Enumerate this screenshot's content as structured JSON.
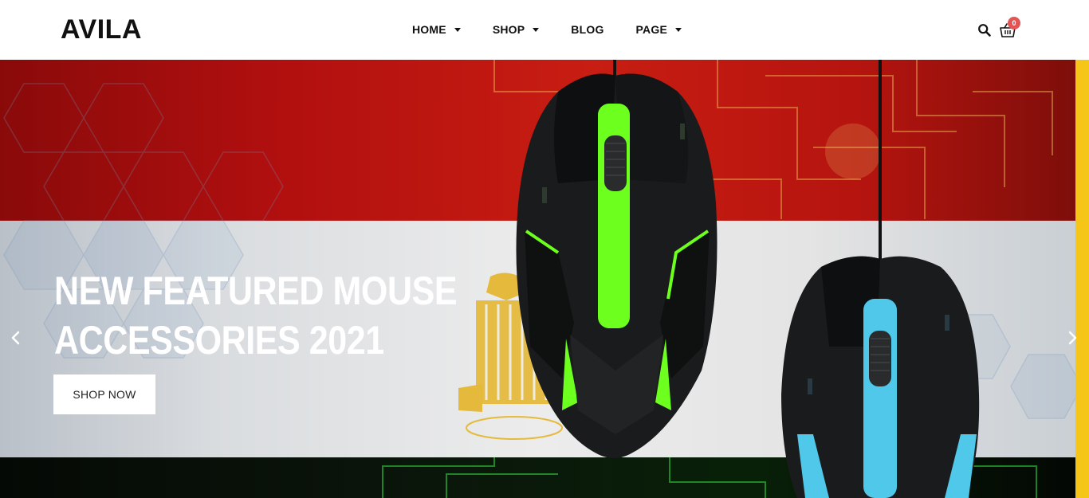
{
  "brand": {
    "logo": "AVILA"
  },
  "nav": {
    "items": [
      {
        "label": "HOME",
        "has_dropdown": true
      },
      {
        "label": "SHOP",
        "has_dropdown": true
      },
      {
        "label": "BLOG",
        "has_dropdown": false
      },
      {
        "label": "PAGE",
        "has_dropdown": true
      }
    ]
  },
  "header_actions": {
    "search_icon": "search-icon",
    "cart_icon": "shopping-basket-icon",
    "cart_count": "0"
  },
  "hero": {
    "title_line1": "NEW FEATURED MOUSE",
    "title_line2": "ACCESSORIES 2021",
    "cta_label": "SHOP NOW",
    "prev_icon": "chevron-left-icon",
    "next_icon": "chevron-right-icon"
  },
  "colors": {
    "accent_yellow": "#f5c518",
    "badge_red": "#e25555",
    "flag_red": "#c81d12",
    "mouse_green": "#6dff1e",
    "mouse_blue": "#4fc8ea"
  }
}
